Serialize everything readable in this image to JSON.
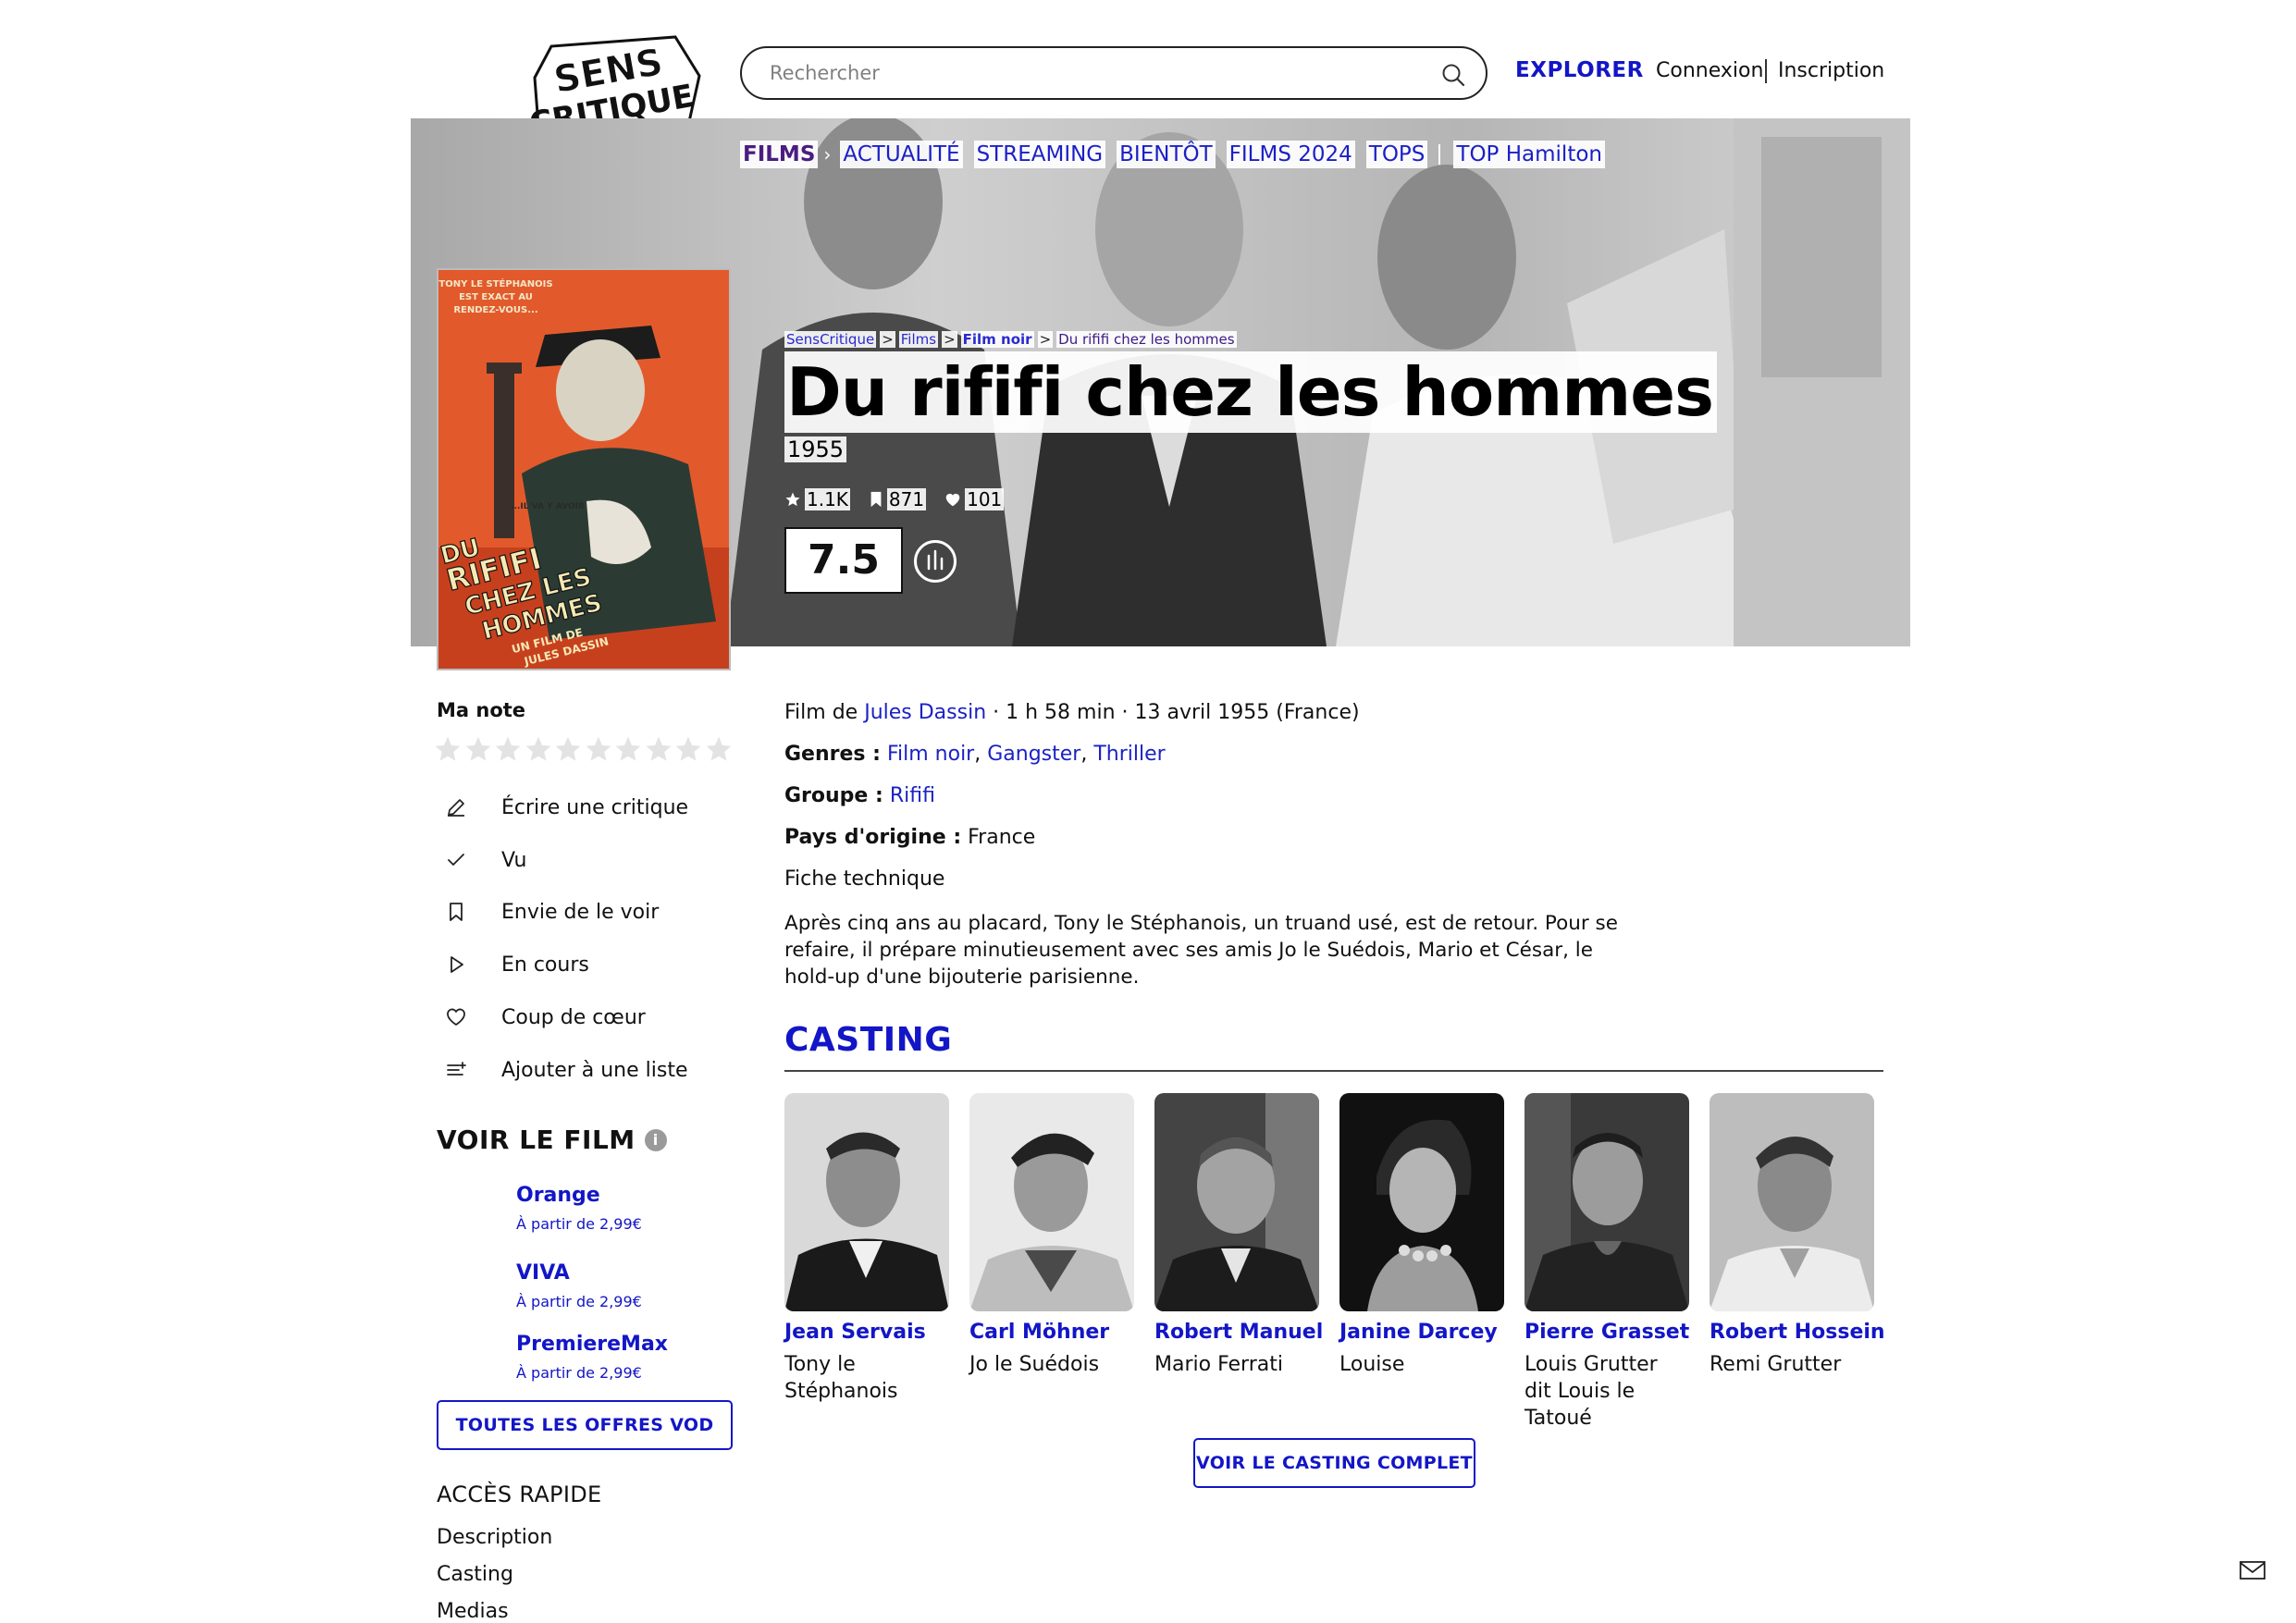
{
  "header": {
    "logo_text": [
      "SENS",
      "CRITIQUE"
    ],
    "search_placeholder": "Rechercher",
    "explore": "EXPLORER",
    "login": "Connexion",
    "signup": "Inscription"
  },
  "nav": {
    "items": [
      "FILMS",
      "ACTUALITÉ",
      "STREAMING",
      "BIENTÔT",
      "FILMS 2024",
      "TOPS",
      "TOP Hamilton"
    ]
  },
  "breadcrumb": [
    "SensCritique",
    "Films",
    "Film noir",
    "Du rififi chez les hommes"
  ],
  "movie": {
    "title": "Du rififi chez les hommes",
    "year": "1955",
    "ratings_count": "1.1K",
    "wishlist_count": "871",
    "favorites_count": "101",
    "score": "7.5",
    "poster_text": {
      "top": [
        "TONY LE STÉPHANOIS",
        "EST EXACT AU",
        "RENDEZ-VOUS..."
      ],
      "middle": "...IL VA Y AVOIR",
      "title": [
        "DU",
        "RIFIFI",
        "CHEZ LES",
        "HOMMES"
      ],
      "credit": [
        "UN FILM DE",
        "JULES DASSIN"
      ]
    }
  },
  "my_note": {
    "label": "Ma note",
    "star_count": 10
  },
  "actions": [
    {
      "label": "Écrire une critique",
      "icon": "pencil-icon"
    },
    {
      "label": "Vu",
      "icon": "check-icon"
    },
    {
      "label": "Envie de le voir",
      "icon": "bookmark-icon"
    },
    {
      "label": "En cours",
      "icon": "play-icon"
    },
    {
      "label": "Coup de cœur",
      "icon": "heart-icon"
    },
    {
      "label": "Ajouter à une liste",
      "icon": "add-list-icon"
    }
  ],
  "voir_le_film": {
    "title": "VOIR LE FILM",
    "offers": [
      {
        "name": "Orange",
        "price": "À partir de 2,99€"
      },
      {
        "name": "VIVA",
        "price": "À partir de 2,99€"
      },
      {
        "name": "PremiereMax",
        "price": "À partir de 2,99€"
      }
    ],
    "all_button": "TOUTES LES OFFRES VOD"
  },
  "acces_rapide": {
    "title": "ACCÈS RAPIDE",
    "links": [
      "Description",
      "Casting",
      "Medias"
    ]
  },
  "details": {
    "film_de_prefix": "Film de",
    "director": "Jules Dassin",
    "meta": "· 1 h 58 min · 13 avril 1955 (France)",
    "genres_label": "Genres :",
    "genres": [
      "Film noir",
      "Gangster",
      "Thriller"
    ],
    "groupe_label": "Groupe :",
    "groupe": "Rififi",
    "pays_label": "Pays d'origine :",
    "pays": "France",
    "fiche": "Fiche technique",
    "synopsis": "Après cinq ans au placard, Tony le Stéphanois, un truand usé, est de retour. Pour se refaire, il prépare minutieusement avec ses amis Jo le Suédois, Mario et César, le hold-up d'une bijouterie parisienne."
  },
  "casting": {
    "title": "CASTING",
    "actors": [
      {
        "name": "Jean Servais",
        "role": "Tony le Stéphanois"
      },
      {
        "name": "Carl Möhner",
        "role": "Jo le Suédois"
      },
      {
        "name": "Robert Manuel",
        "role": "Mario Ferrati"
      },
      {
        "name": "Janine Darcey",
        "role": "Louise"
      },
      {
        "name": "Pierre Grasset",
        "role": "Louis Grutter dit Louis le Tatoué"
      },
      {
        "name": "Robert Hossein",
        "role": "Remi Grutter"
      }
    ],
    "all_button": "VOIR LE CASTING COMPLET"
  },
  "colors": {
    "brand_blue": "#1316c6",
    "nav_active": "#4a1d80",
    "link_blue": "#1b22c4"
  }
}
